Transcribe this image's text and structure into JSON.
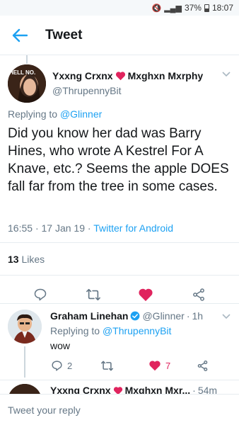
{
  "status_bar": {
    "battery": "37%",
    "time": "18:07"
  },
  "header": {
    "title": "Tweet"
  },
  "main_tweet": {
    "author_name_first": "Yxxng Crxnx",
    "author_name_last": "Mxghxn Mxrphy",
    "handle": "@ThrupennyBit",
    "replying_prefix": "Replying to",
    "replying_handle": "@Glinner",
    "text": "Did you know her dad was Barry Hines, who wrote A Kestrel For A Knave, etc.? Seems the apple DOES fall far from the tree in some cases.",
    "time": "16:55",
    "date": "17 Jan 19",
    "source": "Twitter for Android",
    "likes_count": "13",
    "likes_label": "Likes",
    "avatar_text": "HELL NO."
  },
  "reply_tweet": {
    "author_name": "Graham Linehan",
    "handle": "@Glinner",
    "time_ago": "1h",
    "replying_prefix": "Replying to",
    "replying_handle": "@ThrupennyBit",
    "text": "wow",
    "reply_count": "2",
    "like_count": "7"
  },
  "next_tweet": {
    "author_name_first": "Yxxng Crxnx",
    "author_name_last": "Mxghxn Mxr...",
    "time_ago": "54m"
  },
  "composer": {
    "placeholder": "Tweet your reply"
  },
  "colors": {
    "brand_blue": "#1da1f2",
    "like_red": "#e0245e",
    "gray_text": "#657786"
  },
  "icons": [
    "back-arrow-icon",
    "chevron-down-icon",
    "reply-icon",
    "retweet-icon",
    "heart-icon",
    "share-icon",
    "verified-icon",
    "red-heart-emoji-icon"
  ]
}
